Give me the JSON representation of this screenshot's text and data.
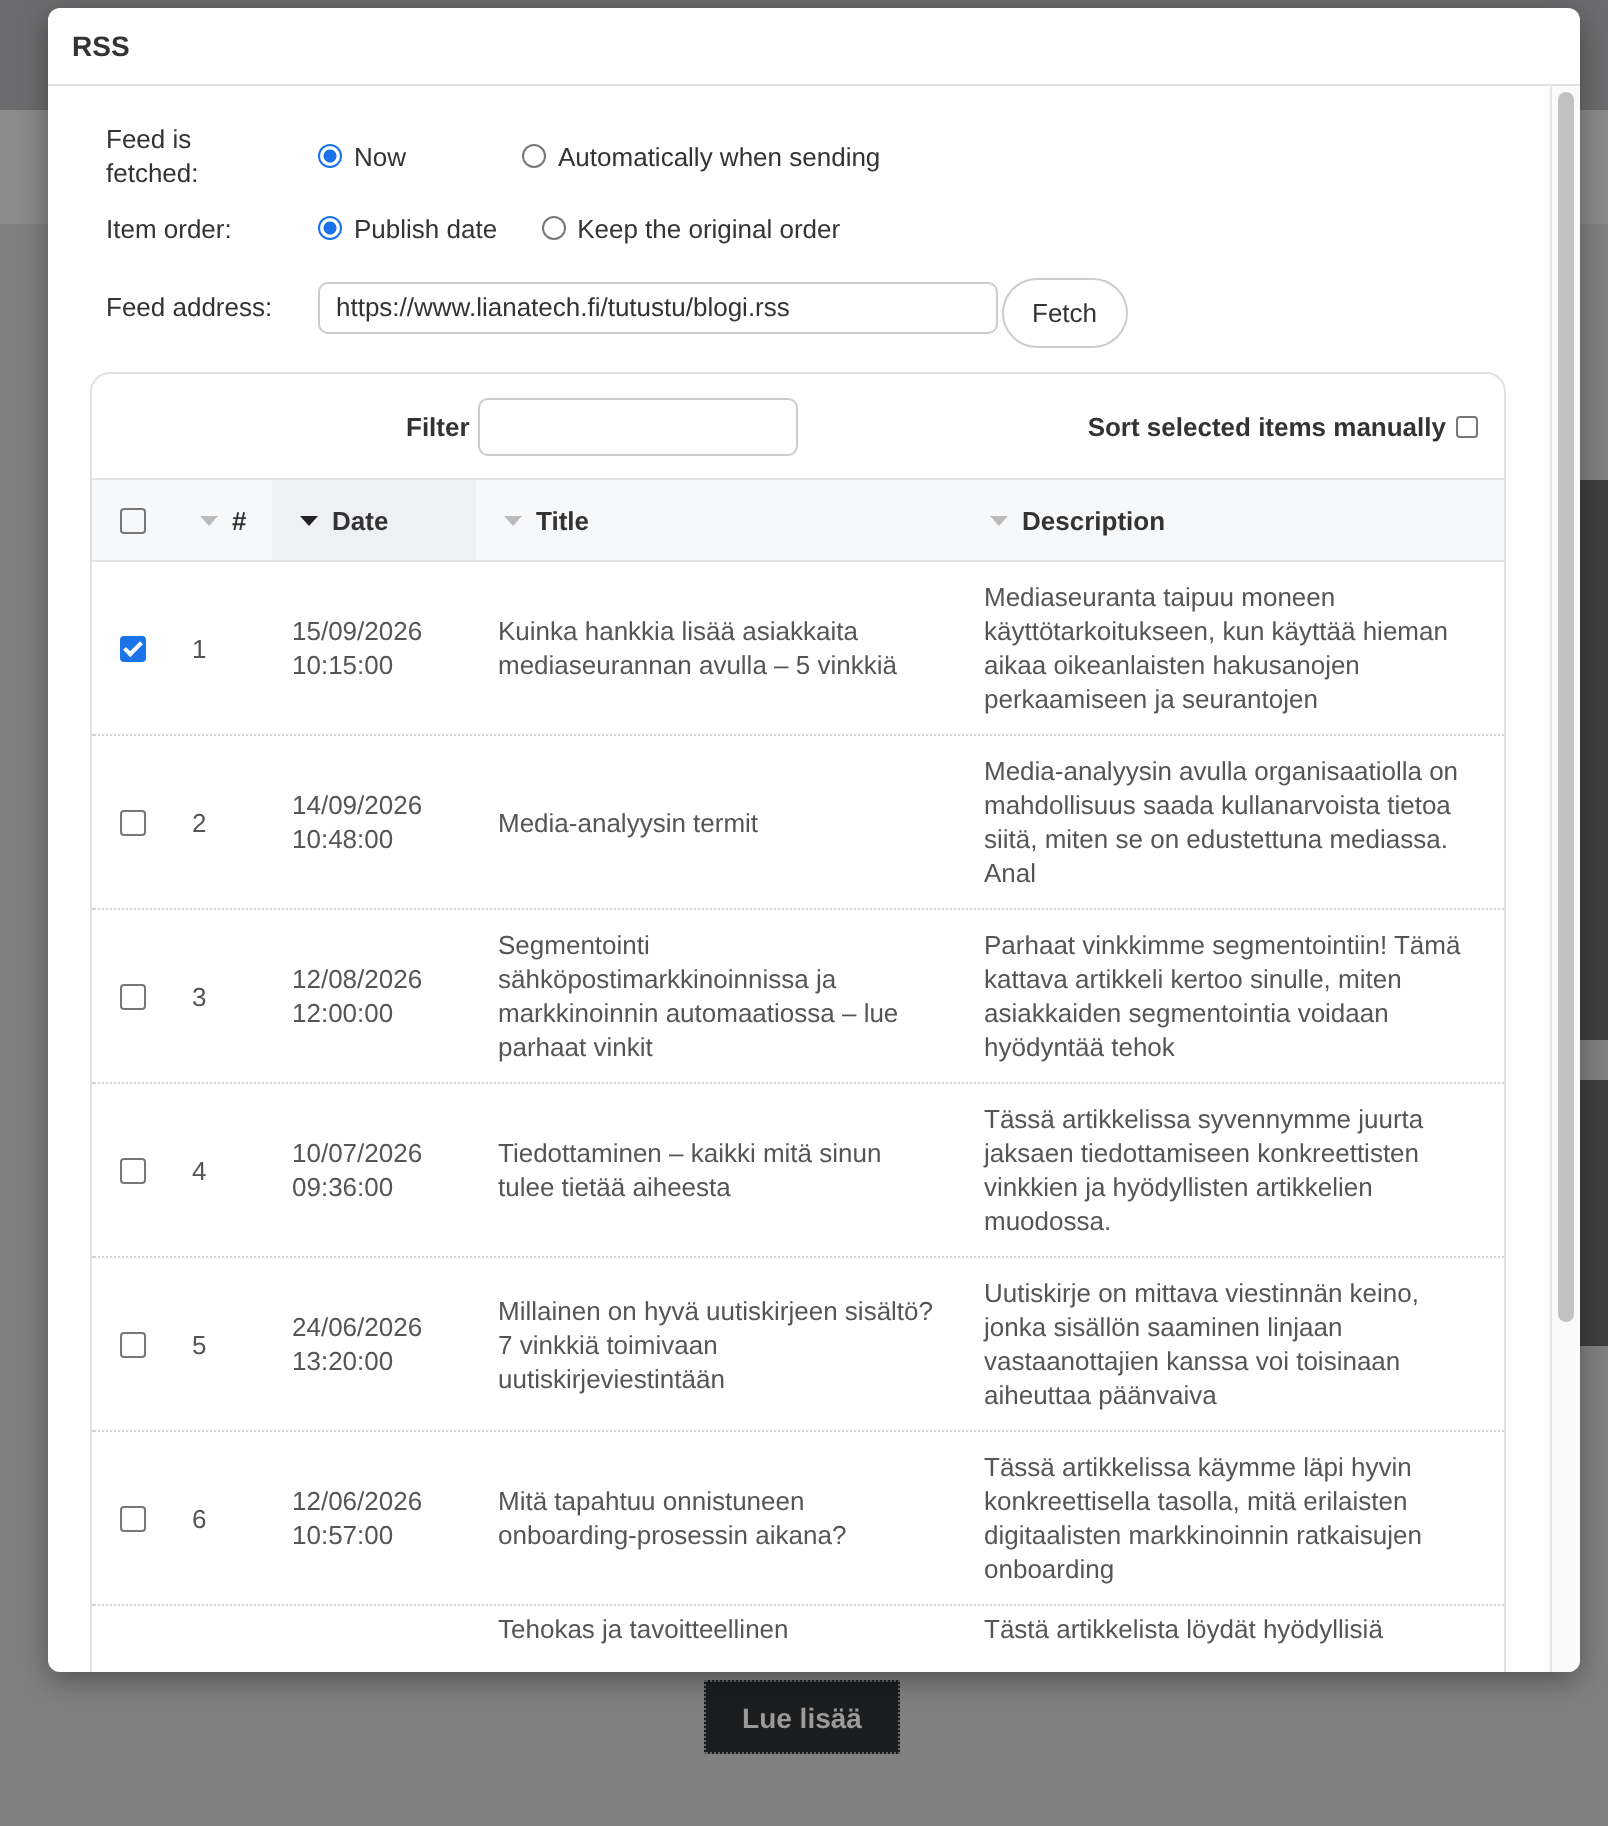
{
  "background": {
    "button": "Lue lisää"
  },
  "dialog": {
    "title": "RSS"
  },
  "settings": [
    {
      "label": "Feed is fetched:",
      "options": [
        {
          "label": "Now",
          "selected": true
        },
        {
          "label": "Automatically when sending",
          "selected": false
        }
      ]
    },
    {
      "label": "Item order:",
      "options": [
        {
          "label": "Publish date",
          "selected": true
        },
        {
          "label": "Keep the original order",
          "selected": false
        }
      ]
    }
  ],
  "feed_address": {
    "label": "Feed address:",
    "value": "https://www.lianatech.fi/tutustu/blogi.rss",
    "button": "Fetch"
  },
  "table": {
    "filter_label": "Filter",
    "sort_manually": {
      "label": "Sort selected items manually",
      "checked": false
    },
    "select_all_checked": false,
    "columns": [
      {
        "label": "#",
        "sorted": false
      },
      {
        "label": "Date",
        "sorted": true
      },
      {
        "label": "Title",
        "sorted": false
      },
      {
        "label": "Description",
        "sorted": false
      }
    ],
    "rows": [
      {
        "checked": true,
        "number": "1",
        "date": "15/09/2026",
        "time": "10:15:00",
        "title": "Kuinka hankkia lisää asiakkaita mediaseurannan avulla – 5 vinkkiä",
        "description": "Mediaseuranta taipuu moneen käyttötarkoitukseen, kun käyttää hieman aikaa oikeanlaisten hakusanojen perkaamiseen ja seurantojen"
      },
      {
        "checked": false,
        "number": "2",
        "date": "14/09/2026",
        "time": "10:48:00",
        "title": "Media-analyysin termit",
        "description": "Media-analyysin avulla organisaatiolla on mahdollisuus saada kullanarvoista tietoa siitä, miten se on edustettuna mediassa. Anal"
      },
      {
        "checked": false,
        "number": "3",
        "date": "12/08/2026",
        "time": "12:00:00",
        "title": "Segmentointi sähköpostimarkkinoinnissa ja markkinoinnin automaatiossa – lue parhaat vinkit",
        "description": "Parhaat vinkkimme segmentointiin! Tämä kattava artikkeli kertoo sinulle, miten asiakkaiden segmentointia voidaan hyödyntää tehok"
      },
      {
        "checked": false,
        "number": "4",
        "date": "10/07/2026",
        "time": "09:36:00",
        "title": "Tiedottaminen – kaikki mitä sinun tulee tietää aiheesta",
        "description": "Tässä artikkelissa syvennymme juurta jaksaen tiedottamiseen konkreettisten vinkkien ja hyödyllisten artikkelien muodossa."
      },
      {
        "checked": false,
        "number": "5",
        "date": "24/06/2026",
        "time": "13:20:00",
        "title": "Millainen on hyvä uutiskirjeen sisältö? 7 vinkkiä toimivaan uutiskirjeviestintään",
        "description": "Uutiskirje on mittava viestinnän keino, jonka sisällön saaminen linjaan vastaanottajien kanssa voi toisinaan aiheuttaa päänvaiva"
      },
      {
        "checked": false,
        "number": "6",
        "date": "12/06/2026",
        "time": "10:57:00",
        "title": "Mitä tapahtuu onnistuneen onboarding-prosessin aikana?",
        "description": "Tässä artikkelissa käymme läpi hyvin konkreettisella tasolla, mitä erilaisten digitaalisten markkinoinnin ratkaisujen onboarding"
      }
    ],
    "partial_row": {
      "title": "Tehokas ja tavoitteellinen",
      "description": "Tästä artikkelista löydät hyödyllisiä"
    }
  }
}
